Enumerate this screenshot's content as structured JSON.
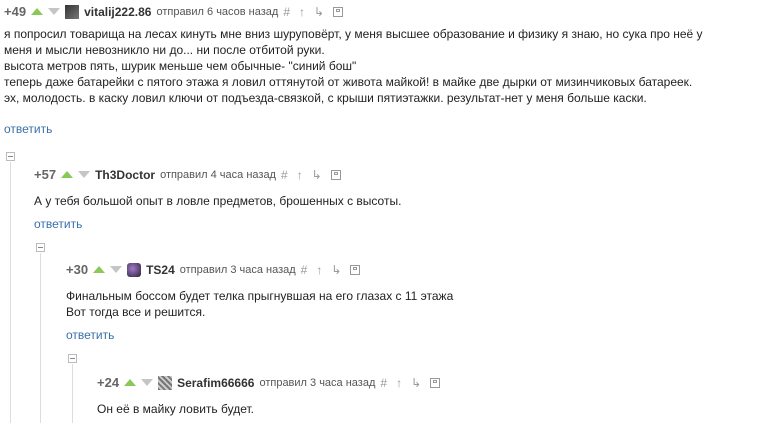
{
  "comments": [
    {
      "rating": "+49",
      "user": "vitalij222.86",
      "meta": "отправил 6 часов назад",
      "lines": [
        "я попросил товарища на лесах кинуть мне вниз шуруповёрт, у меня высшее образование и физику я знаю, но сука про неё у",
        "меня и мысли невозникло ни до... ни после отбитой руки.",
        "высота метров пять, шурик меньше чем обычные- \"синий бош\"",
        "теперь даже батарейки с пятого этажа я ловил оттянутой от живота майкой! в майке две дырки от мизинчиковых батареек.",
        "эх, молодость. в каску ловил ключи от подъезда-связкой, с крыши пятиэтажки. результат-нет у меня больше каски."
      ],
      "reply": "ответить"
    },
    {
      "rating": "+57",
      "user": "Th3Doctor",
      "meta": "отправил 4 часа назад",
      "lines": [
        "А у тебя большой опыт в ловле предметов, брошенных с высоты."
      ],
      "reply": "ответить"
    },
    {
      "rating": "+30",
      "user": "TS24",
      "meta": "отправил 3 часа назад",
      "lines": [
        "Финальным боссом будет телка прыгнувшая на его глазах с 11 этажа",
        "Вот тогда все и решится."
      ],
      "reply": "ответить"
    },
    {
      "rating": "+24",
      "user": "Serafim66666",
      "meta": "отправил 3 часа назад",
      "lines": [
        "Он её в майку ловить будет."
      ]
    }
  ],
  "icons": {
    "hash": "#",
    "up": "↑",
    "branch": "↳"
  },
  "colors": {
    "upvote": "#8ac858",
    "downvote": "#c5c5c5",
    "link": "#3a6fa8"
  }
}
